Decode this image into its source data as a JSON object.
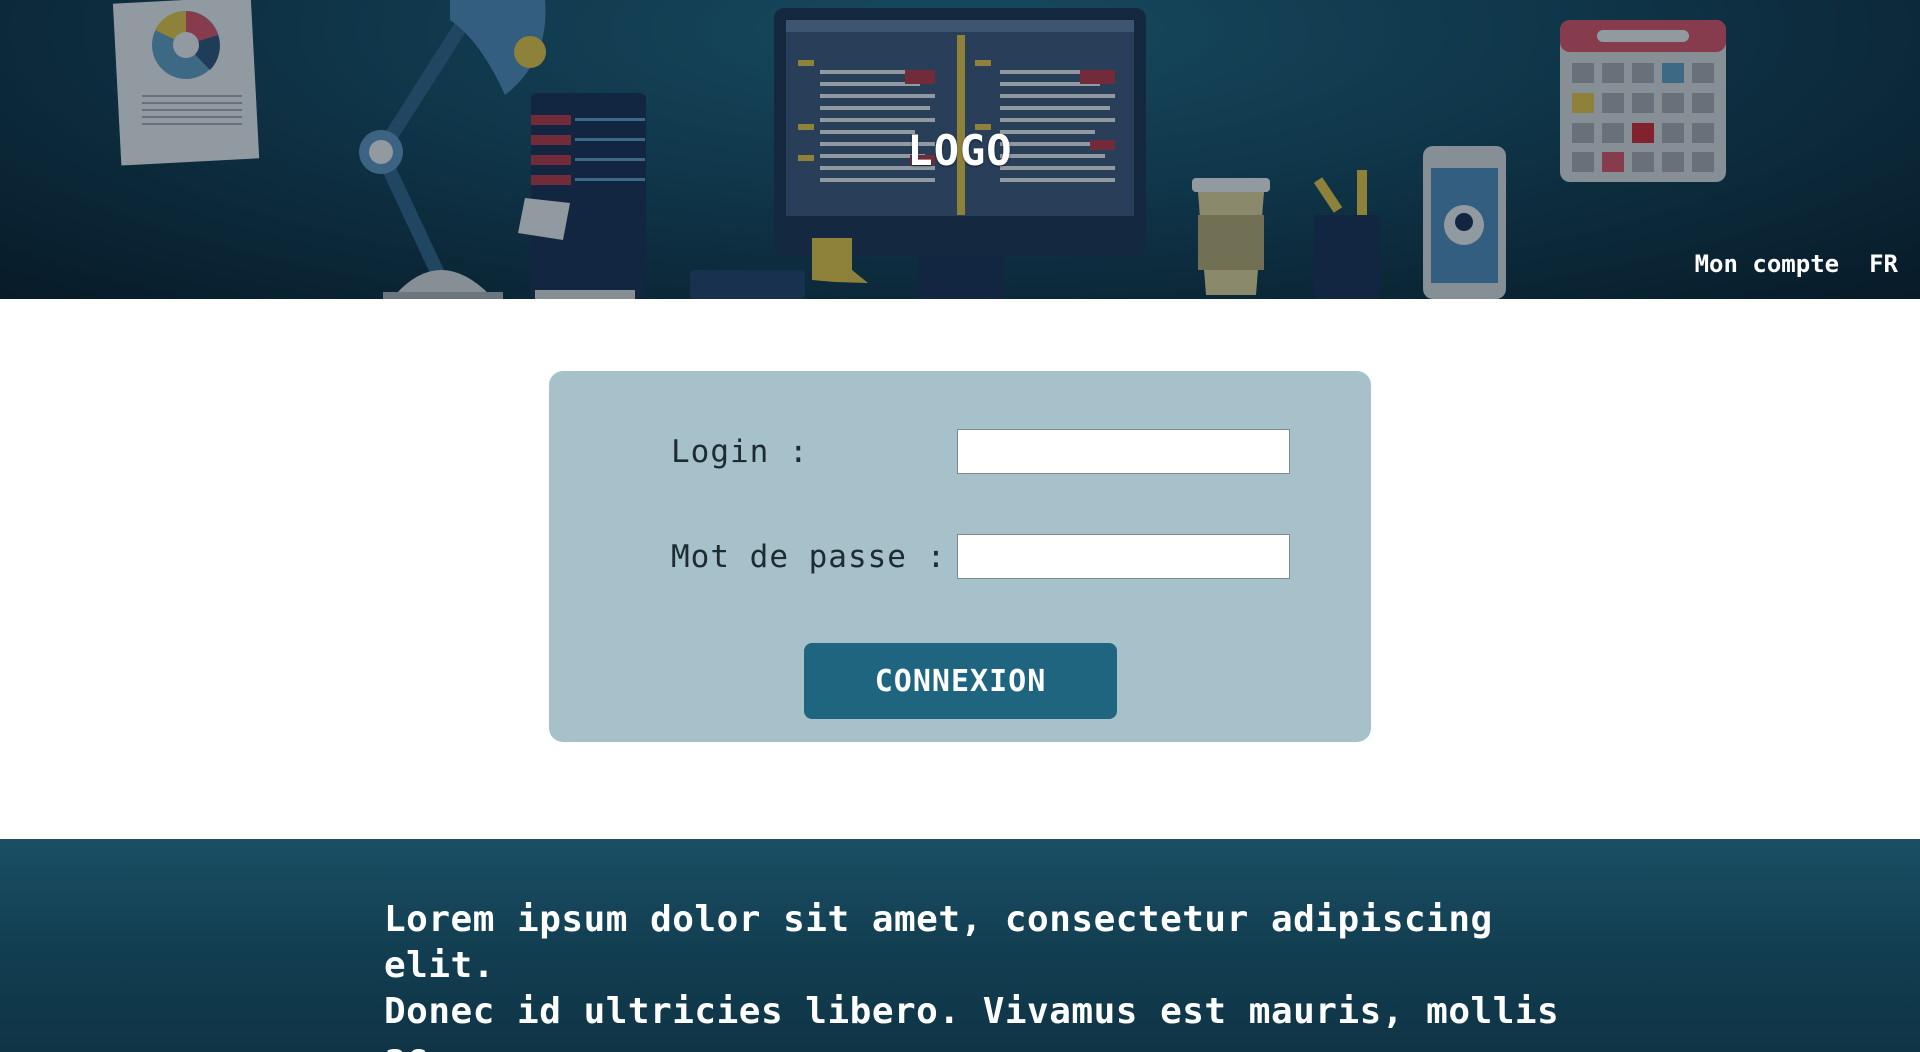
{
  "header": {
    "logo": "LOGO",
    "nav": {
      "account": "Mon compte",
      "language": "FR"
    }
  },
  "login_form": {
    "login_label": "Login :",
    "login_value": "",
    "password_label": "Mot de passe :",
    "password_value": "",
    "submit_label": "CONNEXION"
  },
  "footer": {
    "line1": "Lorem ipsum dolor sit amet, consectetur adipiscing elit.",
    "line2": "Donec id ultricies libero. Vivamus est mauris, mollis ac"
  },
  "colors": {
    "header_bg": "#124055",
    "card_bg": "#a7c1cb",
    "button_bg": "#1f6580",
    "footer_bg": "#123d50"
  }
}
